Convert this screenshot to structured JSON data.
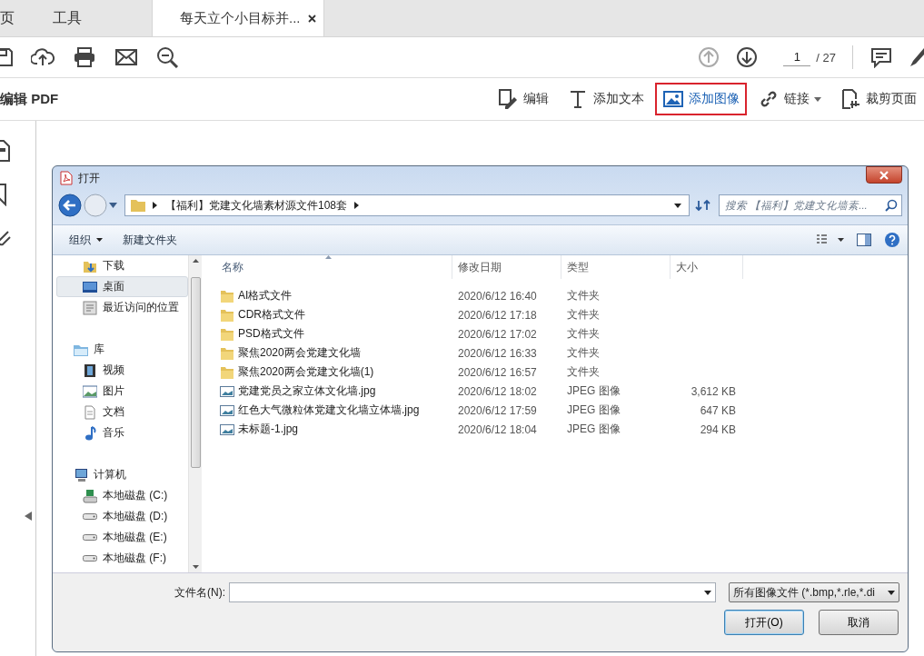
{
  "app_tabs": [
    {
      "label": "页",
      "selected": false,
      "closable": false
    },
    {
      "label": "工具",
      "selected": false,
      "closable": false
    },
    {
      "label": "每天立个小目标并...",
      "selected": true,
      "closable": true
    }
  ],
  "page_nav": {
    "current": "1",
    "total": "/ 27",
    "previous_disabled": true
  },
  "panel_title": "编辑 PDF",
  "edit_tools": [
    {
      "kind": "edit",
      "label": "编辑",
      "selected": false,
      "dropdown": false
    },
    {
      "kind": "text",
      "label": "添加文本",
      "selected": false,
      "dropdown": false
    },
    {
      "kind": "image",
      "label": "添加图像",
      "selected": true,
      "dropdown": false
    },
    {
      "kind": "link",
      "label": "链接",
      "selected": false,
      "dropdown": true
    },
    {
      "kind": "crop",
      "label": "裁剪页面",
      "selected": false,
      "dropdown": false
    }
  ],
  "dialog": {
    "title": "打开",
    "path": [
      "【福利】党建文化墙素材源文件108套"
    ],
    "search": {
      "placeholder": "搜索 【福利】党建文化墙素..."
    },
    "commands": [
      {
        "label": "组织",
        "dropdown": true
      },
      {
        "label": "新建文件夹",
        "dropdown": false
      }
    ],
    "nav": [
      {
        "children": [
          {
            "kind": "downloads",
            "label": "下载",
            "selected": false
          },
          {
            "kind": "desktop",
            "label": "桌面",
            "selected": true
          },
          {
            "kind": "recent",
            "label": "最近访问的位置",
            "selected": false
          }
        ]
      },
      {
        "kind": "library",
        "label": "库",
        "selected": false,
        "children": [
          {
            "kind": "video",
            "label": "视频",
            "selected": false
          },
          {
            "kind": "picture",
            "label": "图片",
            "selected": false
          },
          {
            "kind": "document",
            "label": "文档",
            "selected": false
          },
          {
            "kind": "music",
            "label": "音乐",
            "selected": false
          }
        ]
      },
      {
        "kind": "computer",
        "label": "计算机",
        "selected": false,
        "children": [
          {
            "kind": "system-disk",
            "label": "本地磁盘 (C:)",
            "selected": false
          },
          {
            "kind": "disk",
            "label": "本地磁盘 (D:)",
            "selected": false
          },
          {
            "kind": "disk",
            "label": "本地磁盘 (E:)",
            "selected": false
          },
          {
            "kind": "disk",
            "label": "本地磁盘 (F:)",
            "selected": false
          }
        ]
      }
    ],
    "columns": [
      "名称",
      "修改日期",
      "类型",
      "大小"
    ],
    "files": [
      {
        "kind": "folder",
        "name": "AI格式文件",
        "modified": "2020/6/12 16:40",
        "type": "文件夹"
      },
      {
        "kind": "folder",
        "name": "CDR格式文件",
        "modified": "2020/6/12 17:18",
        "type": "文件夹"
      },
      {
        "kind": "folder",
        "name": "PSD格式文件",
        "modified": "2020/6/12 17:02",
        "type": "文件夹"
      },
      {
        "kind": "folder",
        "name": "聚焦2020两会党建文化墙",
        "modified": "2020/6/12 16:33",
        "type": "文件夹"
      },
      {
        "kind": "folder",
        "name": "聚焦2020两会党建文化墙(1)",
        "modified": "2020/6/12 16:57",
        "type": "文件夹"
      },
      {
        "kind": "image",
        "name": "党建党员之家立体文化墙.jpg",
        "modified": "2020/6/12 18:02",
        "type": "JPEG 图像",
        "size": "3,612 KB"
      },
      {
        "kind": "image",
        "name": "红色大气微粒体党建文化墙立体墙.jpg",
        "modified": "2020/6/12 17:59",
        "type": "JPEG 图像",
        "size": "647 KB"
      },
      {
        "kind": "image",
        "name": "未标题-1.jpg",
        "modified": "2020/6/12 18:04",
        "type": "JPEG 图像",
        "size": "294 KB"
      }
    ],
    "filename": {
      "label": "文件名(N):"
    },
    "filter": "所有图像文件 (*.bmp,*.rle,*.di",
    "buttons": [
      {
        "label": "打开(O)",
        "default": true
      },
      {
        "label": "取消",
        "default": false
      }
    ]
  }
}
